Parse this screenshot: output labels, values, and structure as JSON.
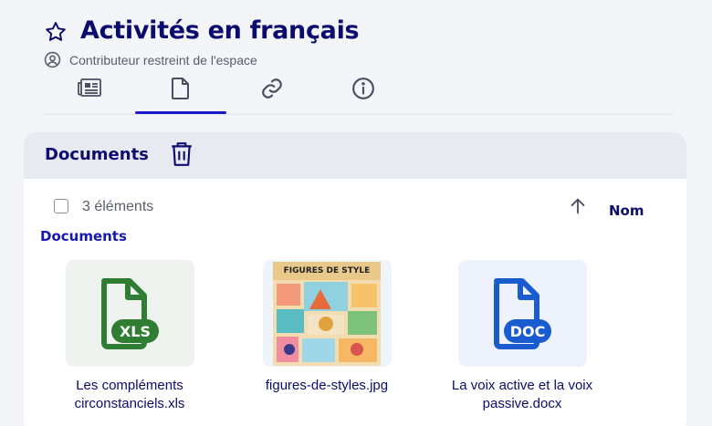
{
  "header": {
    "title": "Activités en français",
    "role": "Contributeur restreint de l'espace",
    "favorite_icon": "star-outline-icon",
    "role_icon": "user-circle-icon"
  },
  "tabs": [
    {
      "icon": "newspaper-icon",
      "active": false
    },
    {
      "icon": "document-icon",
      "active": true
    },
    {
      "icon": "link-icon",
      "active": false
    },
    {
      "icon": "info-icon",
      "active": false
    }
  ],
  "panel": {
    "title": "Documents",
    "delete_icon": "trash-icon",
    "item_count": "3 éléments",
    "sort_icon": "arrow-up-icon",
    "sort_label": "Nom",
    "section_title": "Documents"
  },
  "files": [
    {
      "name": "Les compléments circonstanciels.xls",
      "type_badge": "XLS",
      "color": "#2e7d32",
      "bg": "#eff3f0"
    },
    {
      "name": "figures-de-styles.jpg",
      "image_text": "FIGURES DE STYLE",
      "bg": "#eef4fa"
    },
    {
      "name": "La voix active et la voix passive.docx",
      "type_badge": "DOC",
      "color": "#1a5bd0",
      "bg": "#edf2fc"
    }
  ],
  "colors": {
    "accent": "#1a1ac8",
    "title": "#0c0c70",
    "background": "#f4f5f8"
  }
}
